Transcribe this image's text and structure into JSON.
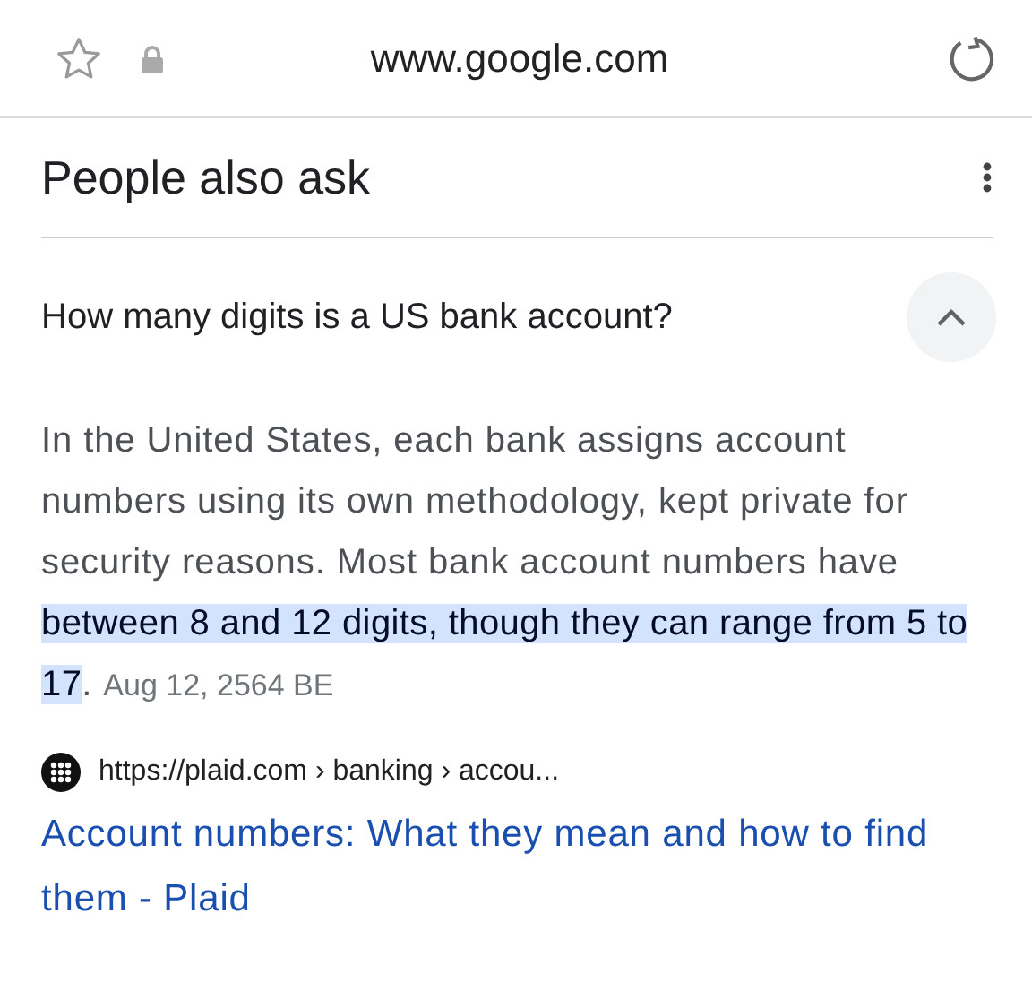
{
  "address_bar": {
    "url": "www.google.com"
  },
  "section": {
    "title": "People also ask"
  },
  "questions": [
    {
      "question": "How many digits is a US bank account?",
      "expanded": true,
      "answer": {
        "text": "In the United States, each bank assigns account numbers using its own methodology, kept private for security reasons. Most bank account numbers have ",
        "highlighted": "between 8 and 12 digits, though they can range from 5 to 17",
        "after": ".",
        "date": "Aug 12, 2564 BE"
      },
      "source": {
        "url": "https://plaid.com › banking › accou...",
        "title": "Account numbers: What they mean and how to find them - Plaid"
      }
    }
  ]
}
